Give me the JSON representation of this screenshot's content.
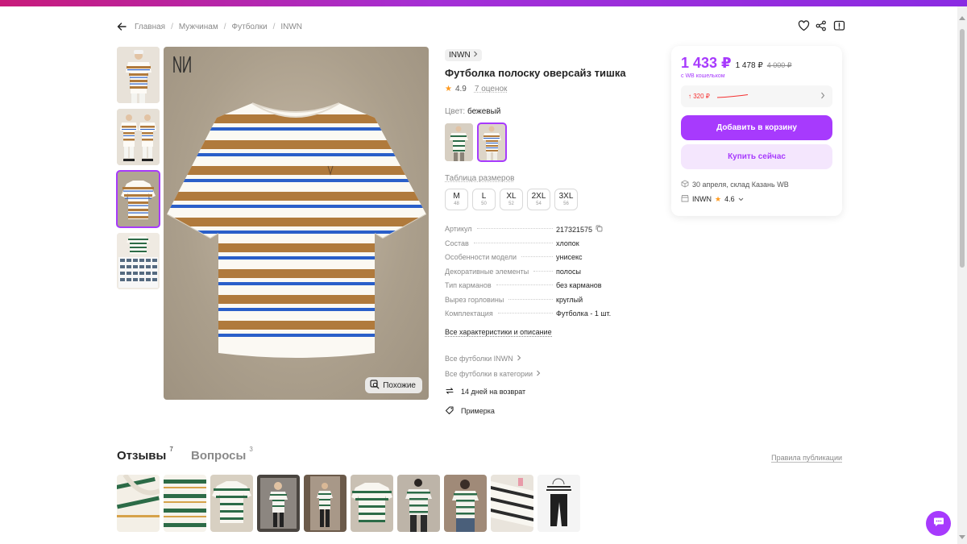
{
  "breadcrumbs": [
    "Главная",
    "Мужчинам",
    "Футболки",
    "INWN"
  ],
  "product": {
    "brand": "INWN",
    "title": "Футболка полоску оверсайз тишка",
    "rating": "4.9",
    "reviews_count": "7 оценок",
    "color_label": "Цвет:",
    "color_value": "бежевый",
    "size_table_link": "Таблица размеров",
    "sizes": [
      {
        "size": "M",
        "ru": "48"
      },
      {
        "size": "L",
        "ru": "50"
      },
      {
        "size": "XL",
        "ru": "52"
      },
      {
        "size": "2XL",
        "ru": "54"
      },
      {
        "size": "3XL",
        "ru": "56"
      }
    ],
    "specs": [
      {
        "key": "Артикул",
        "value": "217321575"
      },
      {
        "key": "Состав",
        "value": "хлопок"
      },
      {
        "key": "Особенности модели",
        "value": "унисекс"
      },
      {
        "key": "Декоративные элементы",
        "value": "полосы"
      },
      {
        "key": "Тип карманов",
        "value": "без карманов"
      },
      {
        "key": "Вырез горловины",
        "value": "круглый"
      },
      {
        "key": "Комплектация",
        "value": "Футболка - 1 шт."
      }
    ],
    "all_specs_link": "Все характеристики и описание",
    "more_links": [
      "Все футболки INWN",
      "Все футболки в категории"
    ],
    "perks": [
      "14 дней на возврат",
      "Примерка"
    ],
    "similar_button": "Похожие"
  },
  "buy": {
    "price": "1 433 ₽",
    "price_no_wallet": "1 478 ₽",
    "price_old": "4 000 ₽",
    "wallet_note": "с WB кошельком",
    "trend": "↑ 320 ₽",
    "add_to_cart": "Добавить в корзину",
    "buy_now": "Купить сейчас",
    "delivery": "30 апреля, склад Казань WB",
    "seller_name": "INWN",
    "seller_rating": "4.6"
  },
  "reviews": {
    "tab_reviews": "Отзывы",
    "reviews_count": "7",
    "tab_questions": "Вопросы",
    "questions_count": "3",
    "rules_link": "Правила публикации"
  },
  "colors": {
    "accent": "#a73afd",
    "accent_light": "#f4e6fd",
    "stripe_brown": "#b07a3c",
    "stripe_blue": "#2a5fc9",
    "price_up": "#f53030",
    "star": "#ff9a1e"
  },
  "icons": [
    "back-arrow-icon",
    "heart-icon",
    "share-icon",
    "report-icon",
    "copy-icon",
    "chevron-right-icon",
    "return-icon",
    "tag-icon",
    "box-icon",
    "shop-icon",
    "chat-icon",
    "search-similar-icon"
  ]
}
